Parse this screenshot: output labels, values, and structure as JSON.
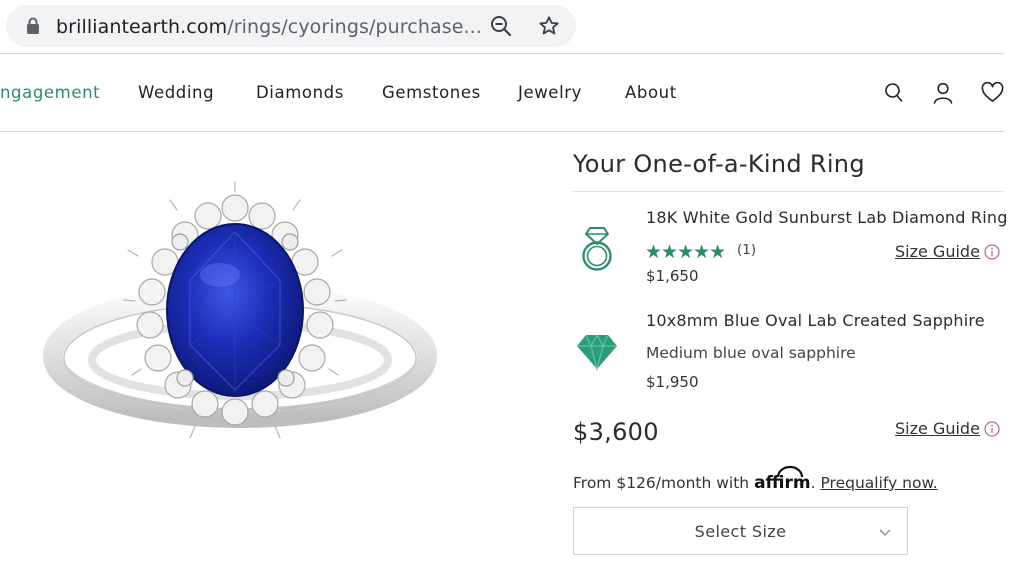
{
  "browser": {
    "url_host": "brilliantearth.com",
    "url_path": "/rings/cyorings/purchase...",
    "icons": [
      "lock-icon",
      "zoom-icon",
      "star-icon"
    ]
  },
  "nav": {
    "items": [
      {
        "label": "ngagement",
        "active": true
      },
      {
        "label": "Wedding"
      },
      {
        "label": "Diamonds"
      },
      {
        "label": "Gemstones"
      },
      {
        "label": "Jewelry"
      },
      {
        "label": "About"
      }
    ],
    "icons": [
      "search-icon",
      "account-icon",
      "wishlist-heart-icon"
    ],
    "active_color": "#2e8b6d"
  },
  "product": {
    "image": "sapphire-halo-ring",
    "panel_title": "Your One-of-a-Kind Ring",
    "setting": {
      "name": "18K White Gold Sunburst Lab Diamond Ring",
      "stars": "★★★★★",
      "rating": 5,
      "review_count": "(1)",
      "price": "$1,650",
      "icon": "ring-icon"
    },
    "stone": {
      "name": "10x8mm Blue Oval Lab Created Sapphire",
      "description": "Medium blue oval sapphire",
      "price": "$1,950",
      "icon": "gem-icon"
    },
    "size_guide": "Size Guide",
    "total_price": "$3,600",
    "financing_prefix": "From $126/month with",
    "financing_brand": "affirm",
    "financing_suffix": ".",
    "prequalify": "Prequalify now.",
    "select_size": "Select Size",
    "accent_color": "#2e8b6d",
    "info_color": "#b06a9a"
  }
}
